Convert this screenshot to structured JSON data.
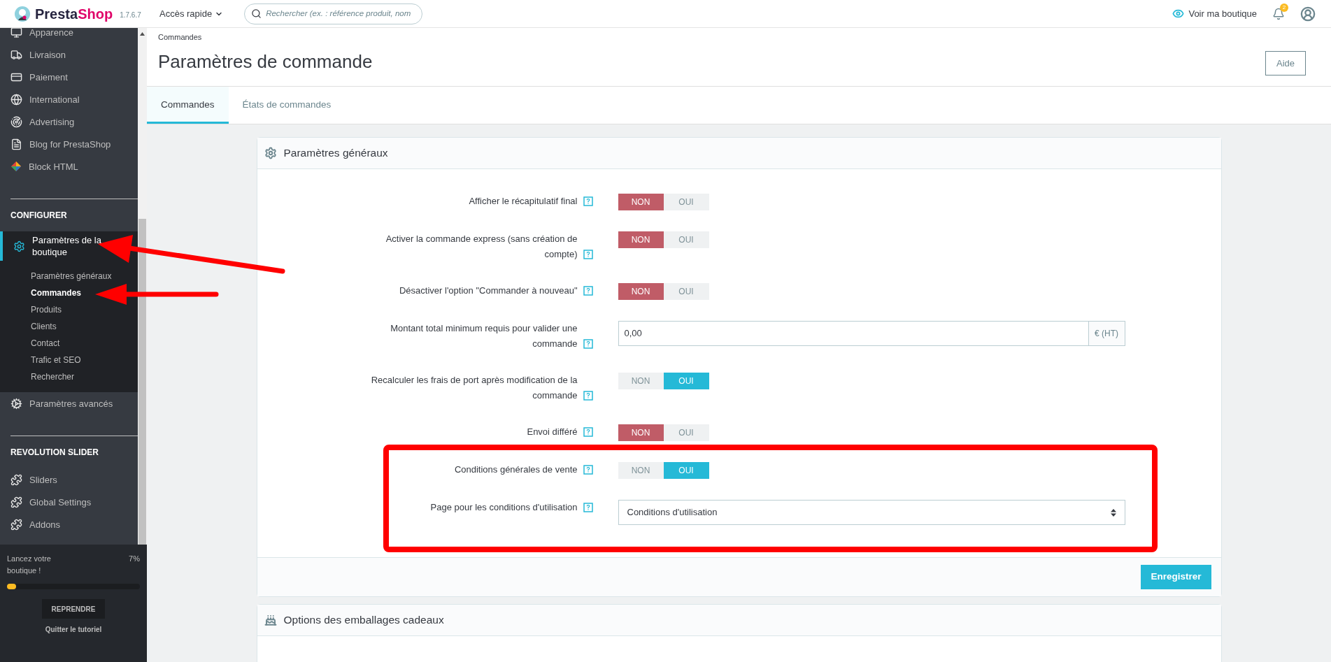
{
  "topbar": {
    "logo": "PrestaShop",
    "version": "1.7.6.7",
    "quick_access": "Accès rapide",
    "search": {
      "placeholder": "Rechercher (ex. : référence produit, nom"
    },
    "view_shop": "Voir ma boutique",
    "notifications": "2"
  },
  "sidebar": {
    "items": [
      {
        "label": "Apparence"
      },
      {
        "label": "Livraison"
      },
      {
        "label": "Paiement"
      },
      {
        "label": "International"
      },
      {
        "label": "Advertising"
      },
      {
        "label": "Blog for PrestaShop"
      },
      {
        "label": "Block HTML"
      }
    ],
    "sections": [
      {
        "heading": "CONFIGURER",
        "items": [
          {
            "label": "Paramètres de la boutique",
            "selected": true,
            "expanded": true,
            "children": [
              {
                "label": "Paramètres généraux",
                "selected": false
              },
              {
                "label": "Commandes",
                "selected": true
              },
              {
                "label": "Produits",
                "selected": false
              },
              {
                "label": "Clients",
                "selected": false
              },
              {
                "label": "Contact",
                "selected": false
              },
              {
                "label": "Trafic et SEO",
                "selected": false
              },
              {
                "label": "Rechercher",
                "selected": false
              }
            ]
          },
          {
            "label": "Paramètres avancés",
            "selected": false
          }
        ]
      },
      {
        "heading": "REVOLUTION SLIDER",
        "items": [
          {
            "label": "Sliders",
            "selected": false
          },
          {
            "label": "Global Settings",
            "selected": false
          },
          {
            "label": "Addons",
            "selected": false
          }
        ]
      }
    ]
  },
  "tutorial": {
    "text": "Lancez votre boutique !",
    "percent": "7%",
    "level": 0.07,
    "button": "REPRENDRE",
    "link": "Quitter le tutoriel"
  },
  "page": {
    "breadcrumb": "Commandes",
    "title": "Paramètres de commande",
    "help_button": "Aide",
    "tabs": [
      {
        "label": "Commandes",
        "selected": true
      },
      {
        "label": "États de commandes",
        "selected": false
      }
    ]
  },
  "panel": {
    "title": "Paramètres généraux",
    "save_button": "Enregistrer",
    "fields": [
      {
        "kind": "toggle",
        "label": "Afficher le récapitulatif final",
        "off_label": "NON",
        "on_label": "OUI",
        "on": false
      },
      {
        "kind": "toggle",
        "label": "Activer la commande express (sans création de compte)",
        "off_label": "NON",
        "on_label": "OUI",
        "on": false
      },
      {
        "kind": "toggle",
        "label": "Désactiver l'option \"Commander à nouveau\"",
        "off_label": "NON",
        "on_label": "OUI",
        "on": false
      },
      {
        "kind": "input",
        "label": "Montant total minimum requis pour valider une commande",
        "value": "0,00",
        "suffix": "€ (HT)"
      },
      {
        "kind": "toggle",
        "label": "Recalculer les frais de port après modification de la commande",
        "off_label": "NON",
        "on_label": "OUI",
        "on": true
      },
      {
        "kind": "toggle",
        "label": "Envoi différé",
        "off_label": "NON",
        "on_label": "OUI",
        "on": false
      },
      {
        "kind": "toggle",
        "label": "Conditions générales de vente",
        "off_label": "NON",
        "on_label": "OUI",
        "on": true
      },
      {
        "kind": "select",
        "label": "Page pour les conditions d'utilisation",
        "value": "Conditions d'utilisation"
      }
    ]
  },
  "panel2": {
    "title": "Options des emballages cadeaux"
  }
}
